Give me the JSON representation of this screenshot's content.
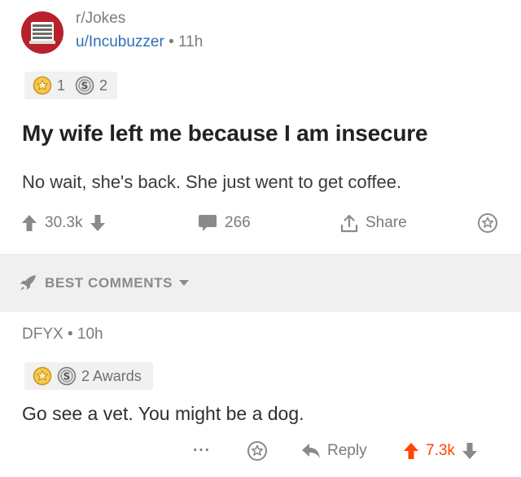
{
  "post": {
    "subreddit": "r/Jokes",
    "author": "u/Incubuzzer",
    "separator": "•",
    "age": "11h",
    "awards": [
      {
        "icon": "gold-award-icon",
        "count": "1"
      },
      {
        "icon": "silver-award-icon",
        "count": "2"
      }
    ],
    "title": "My wife left me because I am insecure",
    "body": "No wait, she's back. She just went to get coffee.",
    "score": "30.3k",
    "comments": "266",
    "share_label": "Share"
  },
  "sort": {
    "label": "BEST COMMENTS"
  },
  "comment": {
    "author": "DFYX",
    "separator": "•",
    "age": "10h",
    "awards_label": "2 Awards",
    "body": "Go see a vet. You might be a dog.",
    "more": "···",
    "reply_label": "Reply",
    "score": "7.3k"
  },
  "colors": {
    "accent_orange": "#ff4500",
    "username_blue": "#2c6fb6",
    "avatar_red": "#b8202c"
  }
}
